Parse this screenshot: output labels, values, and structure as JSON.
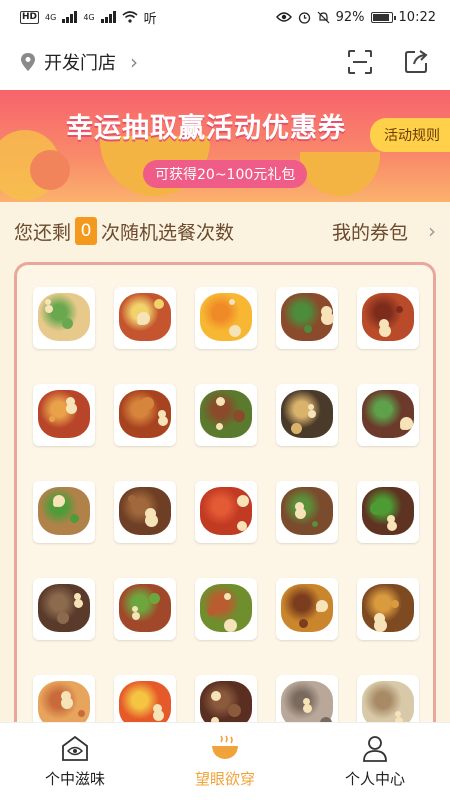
{
  "status_bar": {
    "network_1": "4G",
    "network_2": "4G",
    "speed": "听",
    "battery_percent": "92%",
    "battery_level": 0.92,
    "time": "10:22"
  },
  "header": {
    "store_name": "开发门店",
    "icons": [
      "location-pin-icon",
      "scan-icon",
      "share-icon"
    ]
  },
  "banner": {
    "title": "幸运抽取赢活动优惠券",
    "subtitle": "可获得20~100元礼包",
    "rules_label": "活动规则"
  },
  "info_row": {
    "prefix": "您还剩",
    "count": "0",
    "suffix": "次随机选餐次数",
    "wallet_label": "我的券包"
  },
  "dishes": [
    {
      "name": "dish-chicken",
      "color": "#e7c98b",
      "accent": "#6aa84f"
    },
    {
      "name": "dish-kungpao",
      "color": "#c4552e",
      "accent": "#f2d36b"
    },
    {
      "name": "dish-juice",
      "color": "#f7b733",
      "accent": "#f08a28"
    },
    {
      "name": "dish-stirfry-beef",
      "color": "#8b4a2b",
      "accent": "#4c8c3a"
    },
    {
      "name": "dish-duck",
      "color": "#b94b2a",
      "accent": "#7d2c1c"
    },
    {
      "name": "dish-spicy-chicken",
      "color": "#b8452a",
      "accent": "#e9a14a"
    },
    {
      "name": "dish-braised-pork",
      "color": "#a8431f",
      "accent": "#d7853c"
    },
    {
      "name": "dish-greens-meat",
      "color": "#5a7a2e",
      "accent": "#8b4a2b"
    },
    {
      "name": "dish-eel",
      "color": "#4a3a2a",
      "accent": "#d9b26c"
    },
    {
      "name": "dish-beef-greens",
      "color": "#6b3a2a",
      "accent": "#5fa04a"
    },
    {
      "name": "dish-shredded",
      "color": "#b0824a",
      "accent": "#4f9b3a"
    },
    {
      "name": "dish-beef-stew",
      "color": "#6e3f25",
      "accent": "#a0683c"
    },
    {
      "name": "dish-fish-chili",
      "color": "#c13a22",
      "accent": "#e35a35"
    },
    {
      "name": "dish-mushroom",
      "color": "#7a4b2c",
      "accent": "#5c8f3a"
    },
    {
      "name": "dish-pepper-beef",
      "color": "#5e3322",
      "accent": "#4d9b32"
    },
    {
      "name": "dish-braised-duck",
      "color": "#5a3a2a",
      "accent": "#8c6a4e"
    },
    {
      "name": "dish-spareribs",
      "color": "#a2482a",
      "accent": "#6ea63e"
    },
    {
      "name": "dish-green-pepper",
      "color": "#6f8f2e",
      "accent": "#b95d30"
    },
    {
      "name": "dish-potato-meat",
      "color": "#c9862c",
      "accent": "#7b3d1e"
    },
    {
      "name": "dish-sauce-chicken",
      "color": "#7e4a22",
      "accent": "#d99b3e"
    },
    {
      "name": "dish-noodles",
      "color": "#e7a45c",
      "accent": "#c96a3a"
    },
    {
      "name": "dish-fruit",
      "color": "#e65a2a",
      "accent": "#f4c542"
    },
    {
      "name": "dish-soup-pork",
      "color": "#5a2f22",
      "accent": "#8b5a3c"
    },
    {
      "name": "dish-shellfish",
      "color": "#b9a89a",
      "accent": "#7a6a5e"
    },
    {
      "name": "dish-clear-soup",
      "color": "#d8c9a8",
      "accent": "#a88b66"
    }
  ],
  "bottom_nav": [
    {
      "label": "个中滋味",
      "icon": "home-eye-icon",
      "active": false
    },
    {
      "label": "望眼欲穿",
      "icon": "bowl-icon",
      "active": true
    },
    {
      "label": "个人中心",
      "icon": "person-icon",
      "active": false
    }
  ],
  "colors": {
    "accent": "#f0a33a",
    "count_badge": "#f39a1e",
    "panel_border": "#e9a79b",
    "background": "#fbf3df"
  }
}
